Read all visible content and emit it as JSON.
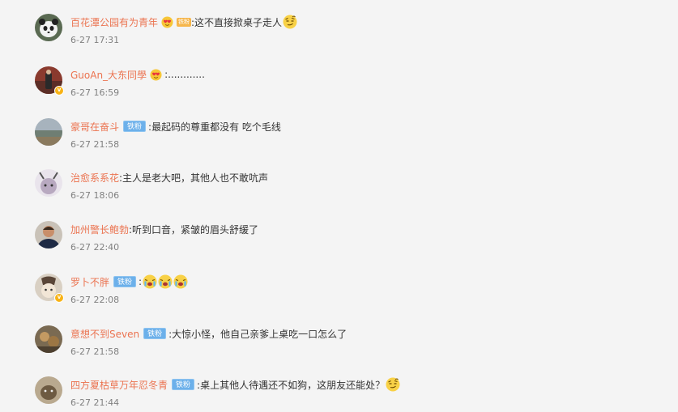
{
  "comments": [
    {
      "user": "百花潭公园有为青年",
      "badge": "",
      "text": ":这不直接掀桌子走人",
      "time": "6-27 17:31"
    },
    {
      "user": "GuoAn_大东同學",
      "badge": "",
      "text": ":............",
      "time": "6-27 16:59"
    },
    {
      "user": "豪哥在奋斗",
      "badge": "铁粉",
      "text": ":最起码的尊重都没有 吃个毛线",
      "time": "6-27 21:58"
    },
    {
      "user": "治愈系系花",
      "badge": "",
      "text": ":主人是老大吧，其他人也不敢吭声",
      "time": "6-27 18:06"
    },
    {
      "user": "加州警长鲍勃",
      "badge": "",
      "text": ":听到口音，紧皱的眉头舒缓了",
      "time": "6-27 22:40"
    },
    {
      "user": "罗卜不胖",
      "badge": "铁粉",
      "text": ":",
      "time": "6-27 22:08"
    },
    {
      "user": "意想不到Seven",
      "badge": "铁粉",
      "text": ":大惊小怪，他自己亲爹上桌吃一口怎么了",
      "time": "6-27 21:58"
    },
    {
      "user": "四方夏枯草万年忍冬青",
      "badge": "铁粉",
      "text": ":桌上其他人待遇还不如狗，这朋友还能处？",
      "time": "6-27 21:44"
    }
  ],
  "badges": {
    "small_fan": "铁粉"
  },
  "colors": {
    "username": "#eb7350",
    "fan_badge": "#6cb0ea",
    "time": "#808080",
    "background": "#f4f4f4"
  },
  "icons": [
    "heart-face-icon",
    "smirk-emoji-icon",
    "crying-emoji-icon",
    "verified-badge-icon"
  ]
}
